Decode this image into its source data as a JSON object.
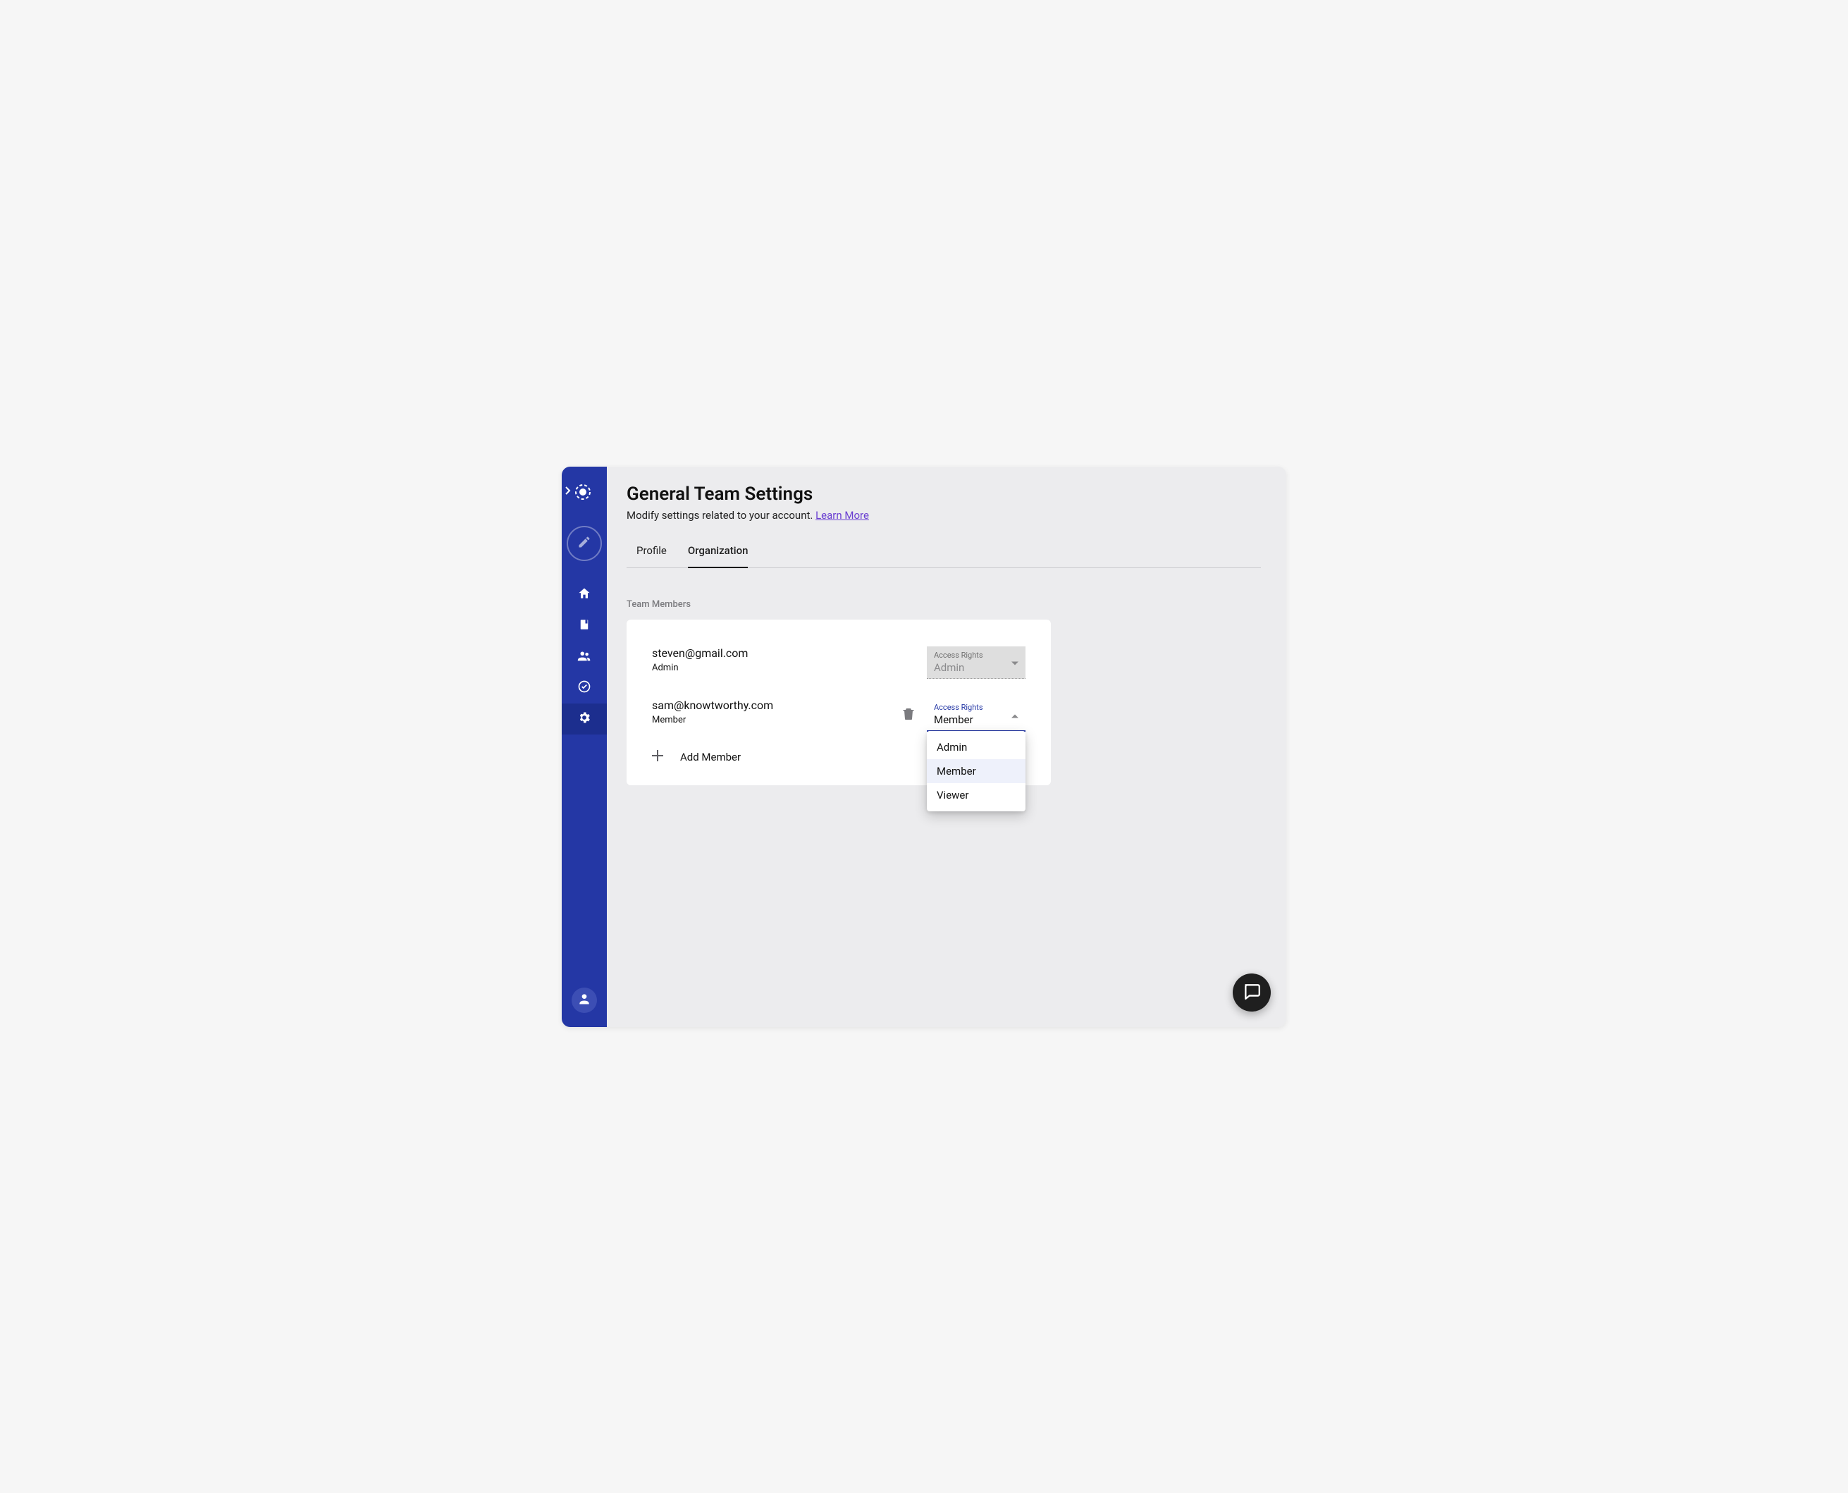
{
  "header": {
    "title": "General Team Settings",
    "subtitle_pre": "Modify settings related to your account. ",
    "learn_more": "Learn More"
  },
  "tabs": {
    "profile": "Profile",
    "organization": "Organization"
  },
  "section": {
    "team_members_label": "Team Members",
    "add_member": "Add Member"
  },
  "access_label": "Access Rights",
  "members": [
    {
      "email": "steven@gmail.com",
      "role": "Admin",
      "access": "Admin",
      "deletable": false,
      "open": false
    },
    {
      "email": "sam@knowtworthy.com",
      "role": "Member",
      "access": "Member",
      "deletable": true,
      "open": true
    }
  ],
  "dropdown_options": [
    "Admin",
    "Member",
    "Viewer"
  ],
  "dropdown_selected": "Member"
}
